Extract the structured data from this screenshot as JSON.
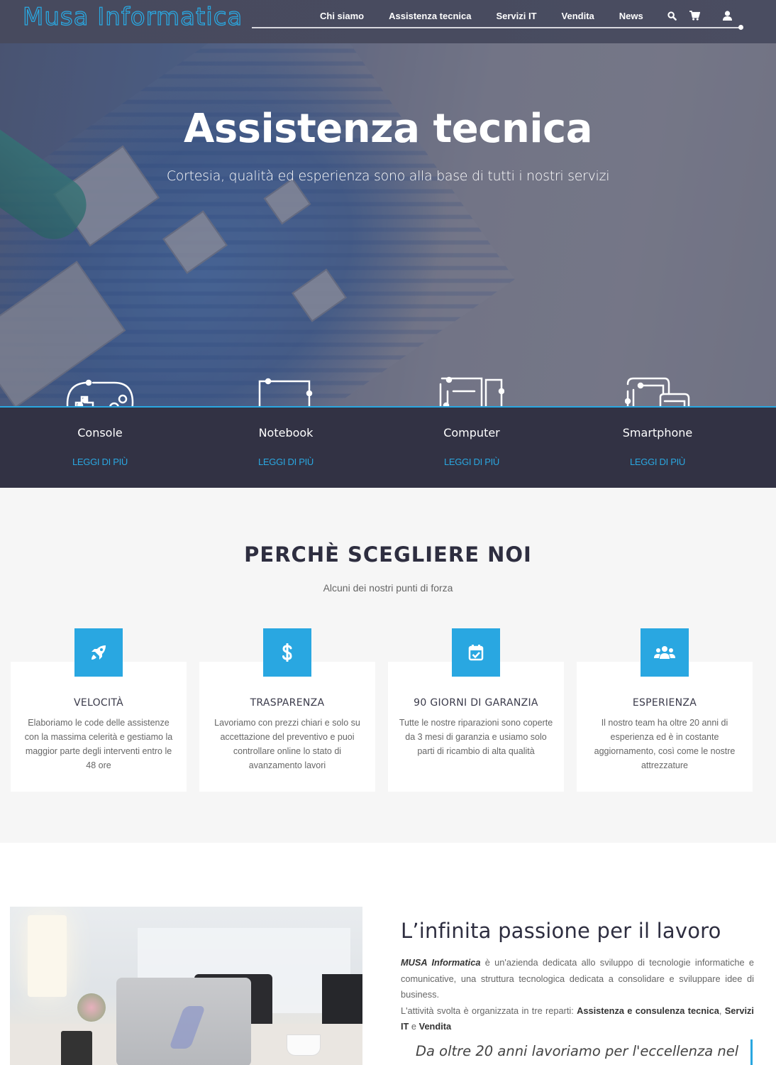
{
  "header": {
    "logo": "Musa Informatica",
    "nav": [
      {
        "label": "Chi siamo"
      },
      {
        "label": "Assistenza tecnica"
      },
      {
        "label": "Servizi IT"
      },
      {
        "label": "Vendita"
      },
      {
        "label": "News"
      }
    ],
    "icons": [
      "search-icon",
      "cart-icon",
      "user-icon"
    ]
  },
  "hero": {
    "title": "Assistenza tecnica",
    "subtitle": "Cortesia, qualità ed esperienza sono alla base di tutti i nostri servizi"
  },
  "categories": [
    {
      "title": "Console",
      "link": "LEGGI DI PIÙ",
      "icon": "gamepad-icon"
    },
    {
      "title": "Notebook",
      "link": "LEGGI DI PIÙ",
      "icon": "laptop-icon"
    },
    {
      "title": "Computer",
      "link": "LEGGI DI PIÙ",
      "icon": "desktop-icon"
    },
    {
      "title": "Smartphone",
      "link": "LEGGI DI PIÙ",
      "icon": "tablet-phone-icon"
    }
  ],
  "why": {
    "title": "PERCHÈ SCEGLIERE NOI",
    "subtitle": "Alcuni dei nostri punti di forza",
    "features": [
      {
        "icon": "rocket-icon",
        "title": "VELOCITÀ",
        "text": "Elaboriamo le code delle assistenze con la massima celerità e gestiamo la maggior parte degli interventi entro le 48 ore"
      },
      {
        "icon": "dollar-icon",
        "title": "TRASPARENZA",
        "text": "Lavoriamo con prezzi chiari e solo su accettazione del preventivo e puoi controllare online lo stato di avanzamento lavori"
      },
      {
        "icon": "calendar-check-icon",
        "title": "90 GIORNI DI GARANZIA",
        "text": "Tutte le nostre riparazioni sono coperte da 3 mesi di garanzia e usiamo solo parti di ricambio di alta qualità"
      },
      {
        "icon": "users-icon",
        "title": "ESPERIENZA",
        "text": "Il nostro team ha oltre 20 anni di esperienza ed è in costante aggiornamento, così come le nostre attrezzature"
      }
    ]
  },
  "about": {
    "title": "L’infinita passione per il lavoro",
    "brand": "MUSA Informatica",
    "p1_rest": " è un'azienda dedicata allo sviluppo di tecnologie informatiche e comunicative, una struttura tecnologica dedicata a consolidare e sviluppare idee di business.",
    "p2_intro": "L'attività svolta è organizzata in tre reparti: ",
    "dept1": "Assistenza e consulenza tecnica",
    "sep1": ", ",
    "dept2": "Servizi IT",
    "sep2": " e ",
    "dept3": "Vendita",
    "quote": "Da oltre 20 anni lavoriamo per l'eccellenza nel"
  },
  "colors": {
    "accent": "#29a7e1",
    "header_bg": "#484b5f",
    "band_bg": "#323244",
    "section_bg": "#f6f6f6",
    "heading": "#2e2e40"
  }
}
